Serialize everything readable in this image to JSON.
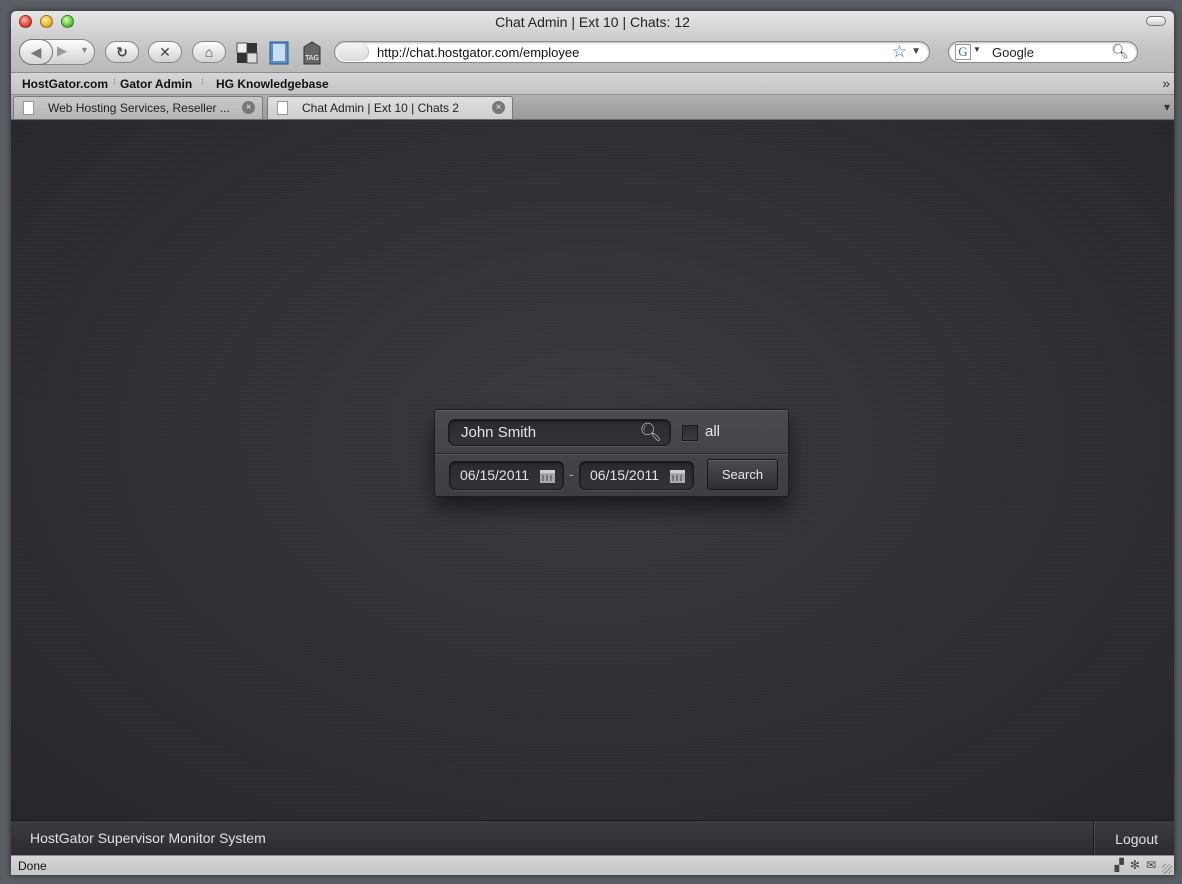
{
  "window": {
    "title": "Chat Admin | Ext 10 | Chats: 12"
  },
  "toolbar": {
    "url": "http://chat.hostgator.com/employee",
    "search_engine_placeholder": "Google"
  },
  "bookmarks": [
    "HostGator.com",
    "Gator Admin",
    "HG Knowledgebase"
  ],
  "tabs": [
    {
      "label": "Web Hosting Services, Reseller ...",
      "active": false
    },
    {
      "label": "Chat Admin | Ext 10 | Chats 2",
      "active": true
    }
  ],
  "search_panel": {
    "name_value": "John Smith",
    "all_label": "all",
    "all_checked": false,
    "date_from": "06/15/2011",
    "date_separator": "-",
    "date_to": "06/15/2011",
    "search_button": "Search"
  },
  "footer": {
    "brand": "HostGator Supervisor Monitor System",
    "logout": "Logout"
  },
  "status": {
    "text": "Done"
  }
}
